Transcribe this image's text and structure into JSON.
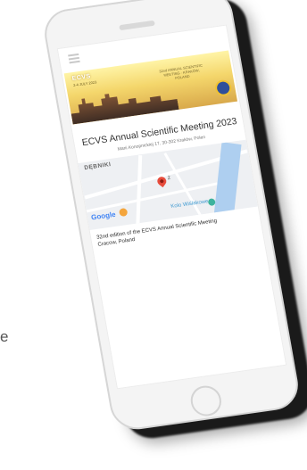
{
  "side_char": "e",
  "app": {
    "menu_icon": "hamburger-menu-icon",
    "user_icon": "user-account-icon"
  },
  "banner": {
    "acronym": "ECVS",
    "dates": "2-4 JULY 2023",
    "tagline": "32nd ANNUAL SCIENTIFIC MEETING · KRAKÓW, POLAND",
    "logo_icon": "society-emblem-logo"
  },
  "event": {
    "title": "ECVS Annual Scientific Meeting 2023",
    "address": "Marii Konopnickiej 17, 30-302 Kraków, Polen",
    "description_line1": "32nd edition of the ECVS Annual Scientific Meeting",
    "description_line2": "Cracow, Poland"
  },
  "map": {
    "district": "DĘBNIKI",
    "provider": "Google",
    "river_label": "Kolo Wiślakowe",
    "pin_icon": "location-pin-icon",
    "pin_label": "Ż",
    "food_icon": "restaurant-marker-icon",
    "poi_icon": "place-marker-icon"
  },
  "colors": {
    "pin": "#e74c3c",
    "river": "#aecff0",
    "banner_gold": "#f4d66b",
    "phone_body": "#f4f4f4",
    "google_blue": "#4285f4",
    "google_red": "#ea4335",
    "google_yellow": "#fbbc05",
    "google_green": "#34a853"
  }
}
